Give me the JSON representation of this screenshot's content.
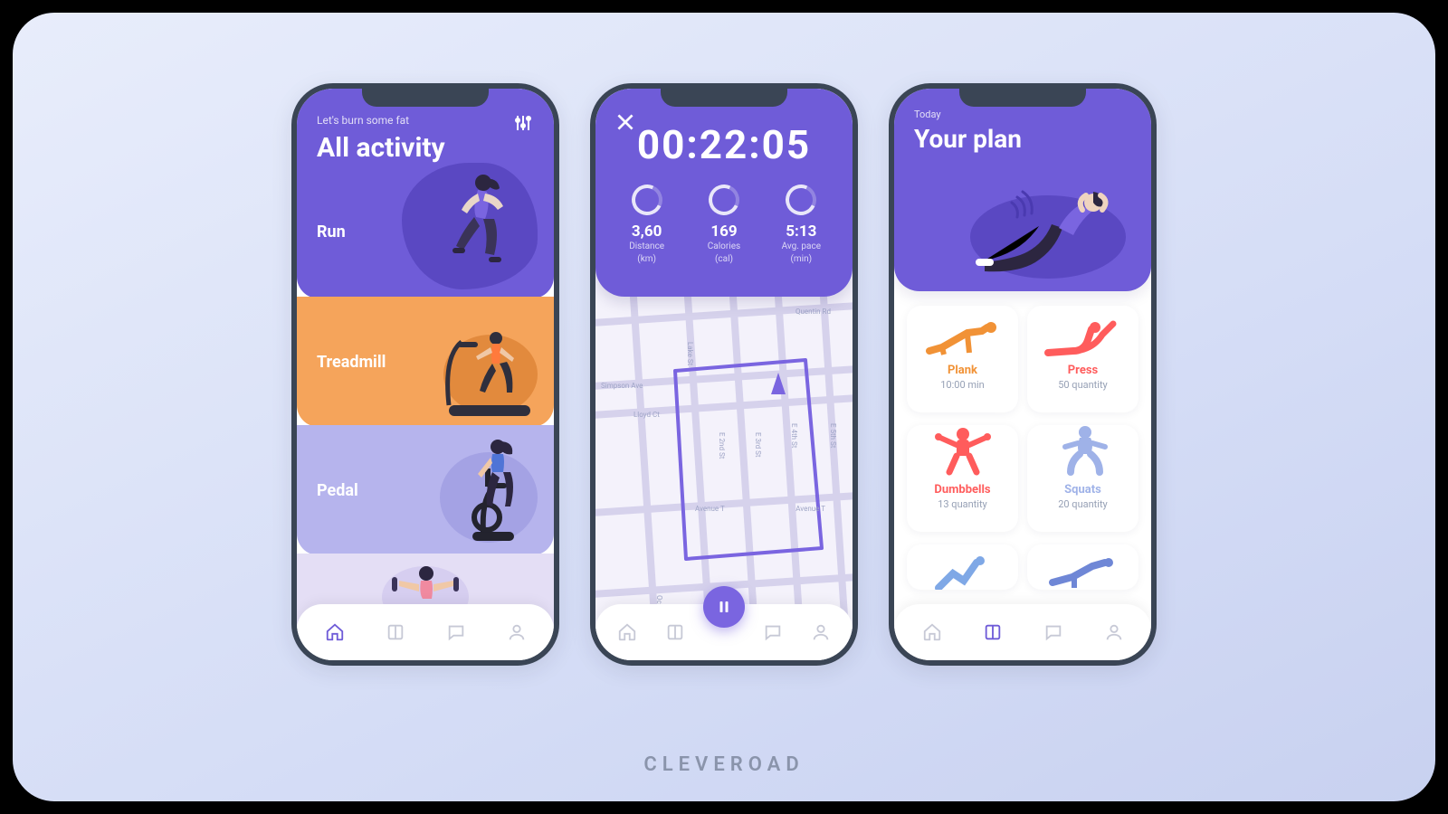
{
  "brand": "CLEVEROAD",
  "screen1": {
    "tagline": "Let's burn some fat",
    "title": "All activity",
    "activities": [
      {
        "label": "Run"
      },
      {
        "label": "Treadmill"
      },
      {
        "label": "Pedal"
      }
    ]
  },
  "screen2": {
    "timer": "00:22:05",
    "stats": [
      {
        "value": "3,60",
        "label": "Distance",
        "unit": "(km)"
      },
      {
        "value": "169",
        "label": "Calories",
        "unit": "(cal)"
      },
      {
        "value": "5:13",
        "label": "Avg. pace",
        "unit": "(min)"
      }
    ],
    "streets": [
      "Quentin Rd",
      "Simpson Ave",
      "Lloyd Ct",
      "Avenue T",
      "Avenue U",
      "Ocean Pkwy",
      "E 2nd St",
      "E 3rd St",
      "E 4th St",
      "E 5th St",
      "Lake St"
    ]
  },
  "screen3": {
    "today": "Today",
    "title": "Your plan",
    "exercises": [
      {
        "title": "Plank",
        "sub": "10:00 min",
        "color": "c-orange"
      },
      {
        "title": "Press",
        "sub": "50 quantity",
        "color": "c-red"
      },
      {
        "title": "Dumbbells",
        "sub": "13 quantity",
        "color": "c-red"
      },
      {
        "title": "Squats",
        "sub": "20 quantity",
        "color": "c-blue"
      }
    ]
  },
  "icons": {
    "pause": "pause-icon"
  }
}
